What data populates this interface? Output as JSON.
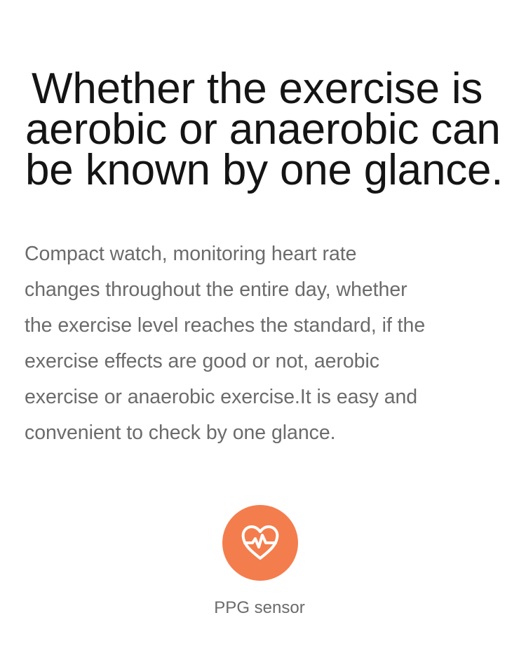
{
  "headline": {
    "lines": [
      "Whether the exercise is",
      "aerobic or anaerobic can",
      "be known by one glance."
    ]
  },
  "description": {
    "lines": [
      "Compact watch, monitoring heart rate",
      "changes throughout the entire day, whether",
      "the exercise level reaches the standard, if the",
      "exercise effects are good or not, aerobic",
      "exercise or anaerobic exercise.It is easy and",
      "convenient to check by one glance."
    ]
  },
  "sensor": {
    "icon": "heart-pulse-icon",
    "label": "PPG sensor",
    "accent_color": "#f47d4d"
  }
}
